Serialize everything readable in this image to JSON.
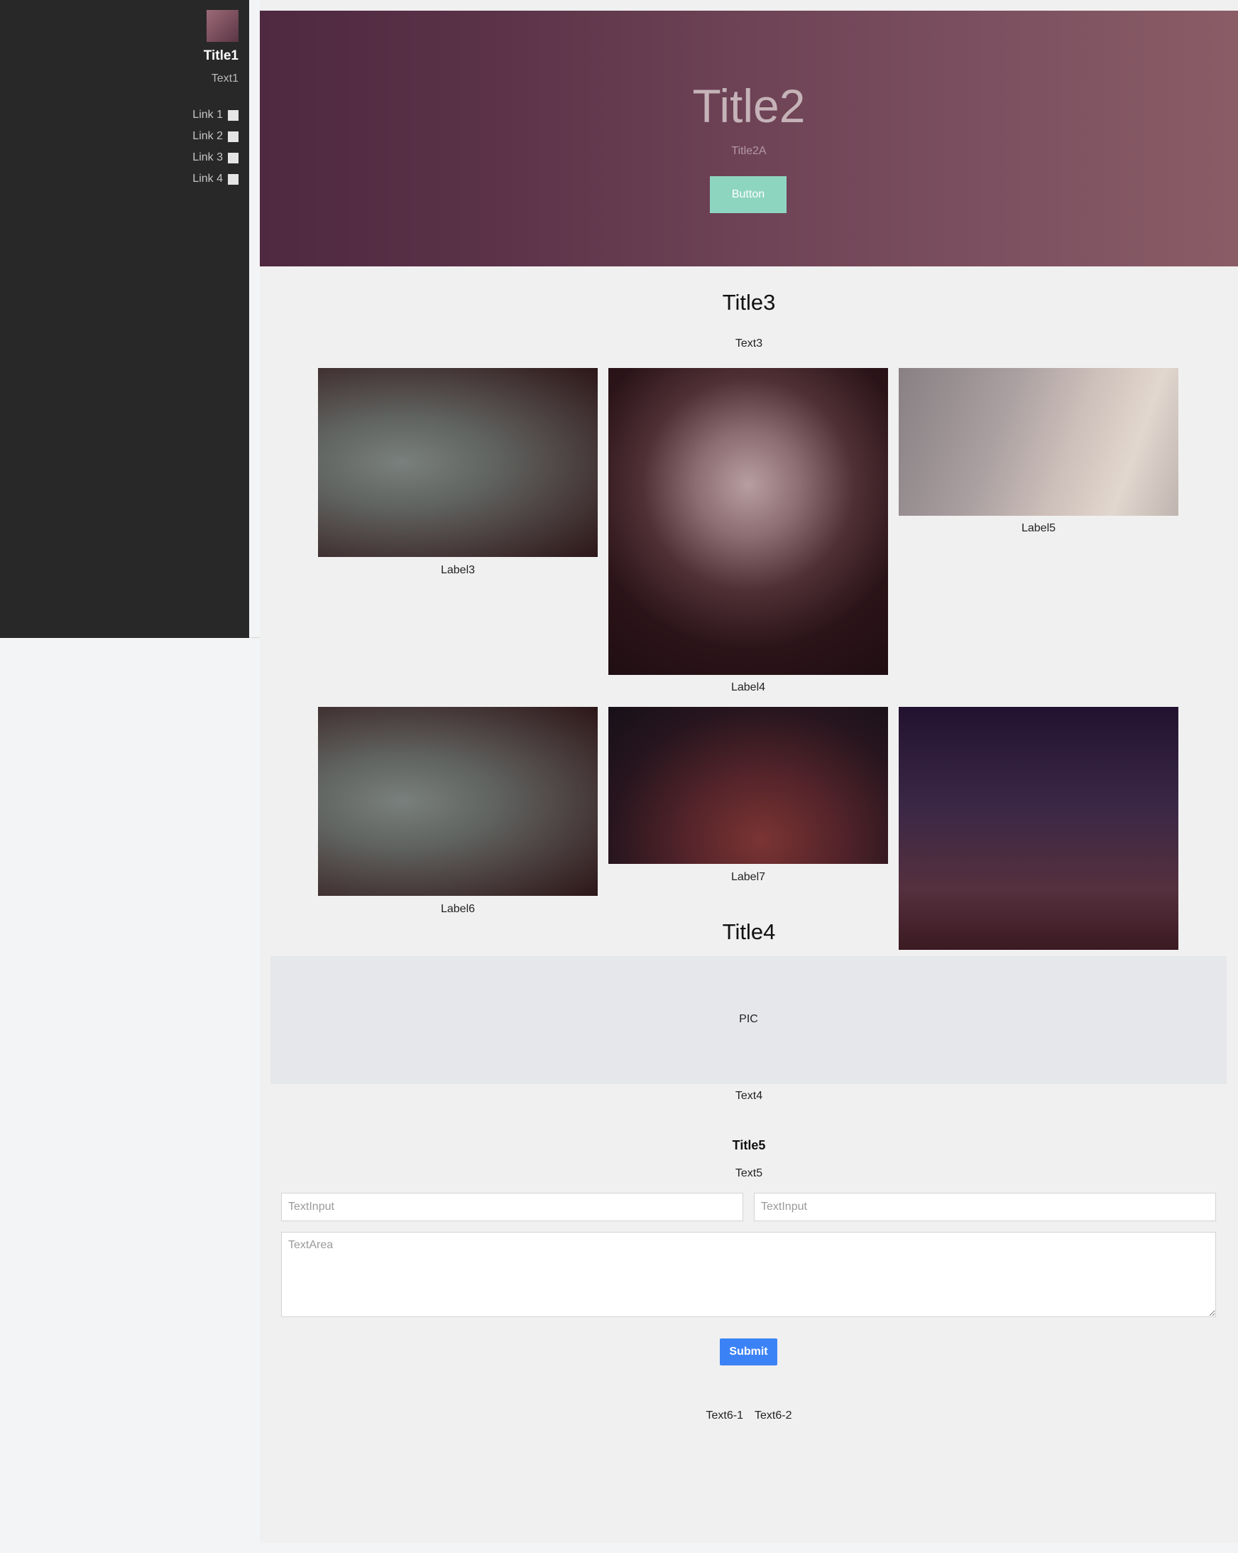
{
  "sidebar": {
    "title": "Title1",
    "text": "Text1",
    "links": [
      {
        "label": "Link 1"
      },
      {
        "label": "Link 2"
      },
      {
        "label": "Link 3"
      },
      {
        "label": "Link 4"
      }
    ]
  },
  "hero": {
    "title": "Title2",
    "subtitle": "Title2A",
    "button_label": "Button"
  },
  "gallery": {
    "title": "Title3",
    "text": "Text3",
    "items": [
      {
        "label": "Label3"
      },
      {
        "label": "Label4"
      },
      {
        "label": "Label5"
      },
      {
        "label": "Label6"
      },
      {
        "label": "Label7"
      }
    ]
  },
  "section4": {
    "title": "Title4",
    "pic_label": "PIC",
    "text": "Text4"
  },
  "form": {
    "title": "Title5",
    "text": "Text5",
    "input1_placeholder": "TextInput",
    "input2_placeholder": "TextInput",
    "textarea_placeholder": "TextArea",
    "submit_label": "Submit"
  },
  "footer": {
    "text1": "Text6-1",
    "text2": "Text6-2"
  }
}
